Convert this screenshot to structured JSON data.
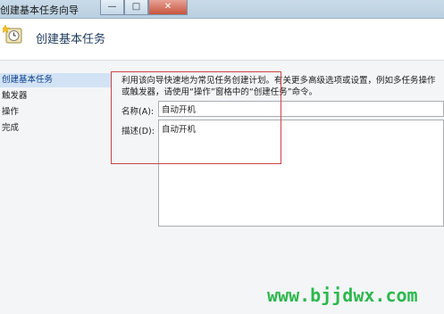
{
  "window": {
    "title": "创建基本任务向导",
    "controls": {
      "minimize": "—",
      "maximize": "□",
      "close": "✕"
    }
  },
  "header": {
    "icon": "wizard-clock-icon",
    "heading": "创建基本任务"
  },
  "nav": {
    "items": [
      {
        "label": "创建基本任务",
        "active": true
      },
      {
        "label": "触发器",
        "active": false
      },
      {
        "label": "操作",
        "active": false
      },
      {
        "label": "完成",
        "active": false
      }
    ]
  },
  "form": {
    "intro": "利用该向导快速地为常见任务创建计划。有关更多高级选项或设置，例如多任务操作或触发器，请使用“操作”窗格中的“创建任务”命令。",
    "name_label": "名称(A):",
    "name_value": "自动开机",
    "desc_label": "描述(D):",
    "desc_value": "自动开机"
  },
  "watermark": "www.bjjdwx.com",
  "colors": {
    "annotation": "#c84545",
    "watermark": "#2db84d",
    "nav_active": "#d2e3f5"
  }
}
